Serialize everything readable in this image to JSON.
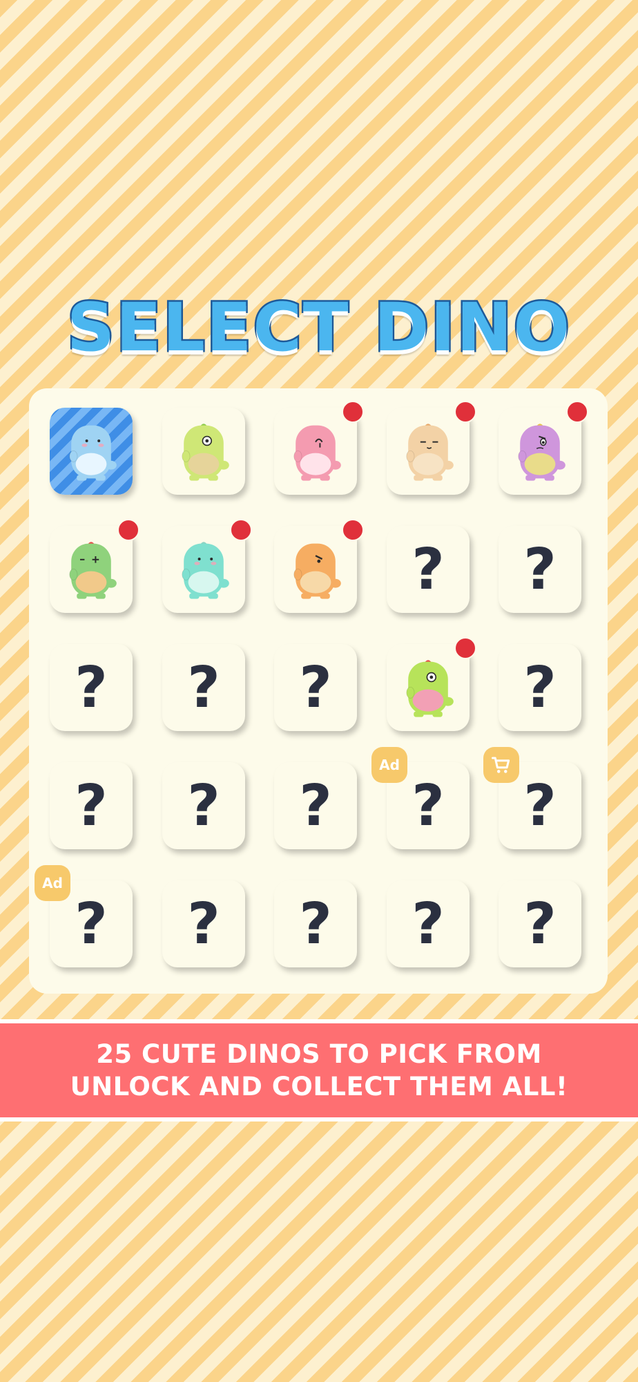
{
  "title": "SELECT DINO",
  "colors": {
    "background_stripe_dark": "#fbd48a",
    "background_stripe_light": "#fdf0cf",
    "panel": "#fdfbea",
    "selected_stripe": "#3f8ee6",
    "notification_dot": "#e0303a",
    "badge": "#f7c96b",
    "banner": "#fe6f72",
    "question_mark": "#2b3040"
  },
  "grid": {
    "rows": [
      [
        {
          "state": "unlocked",
          "selected": true,
          "dino": {
            "body": "#9fd3f3",
            "belly": "#e8f6ff",
            "eyes": "dots",
            "crest": "none"
          }
        },
        {
          "state": "unlocked",
          "dino": {
            "body": "#cfe776",
            "belly": "#e6d49a",
            "eyes": "single",
            "crest": "#8ccb4a"
          }
        },
        {
          "state": "unlocked",
          "dot": true,
          "dino": {
            "body": "#f49bb0",
            "belly": "#ffe3ea",
            "eyes": "wink",
            "crest": "none"
          }
        },
        {
          "state": "unlocked",
          "dot": true,
          "dino": {
            "body": "#f3d2a6",
            "belly": "#f7e3c4",
            "eyes": "sleepy",
            "crest": "#e8a86a"
          }
        },
        {
          "state": "unlocked",
          "dot": true,
          "dino": {
            "body": "#cf96dc",
            "belly": "#e9dc8a",
            "eyes": "grumpy",
            "crest": "#e8c64a"
          }
        }
      ],
      [
        {
          "state": "unlocked",
          "dot": true,
          "dino": {
            "body": "#8fd27c",
            "belly": "#f1c98a",
            "eyes": "cross",
            "crest": "#e84b4b"
          }
        },
        {
          "state": "unlocked",
          "dot": true,
          "dino": {
            "body": "#7fe0cf",
            "belly": "#d7f7ef",
            "eyes": "dots",
            "crest": "#8cd2c2"
          }
        },
        {
          "state": "unlocked",
          "dot": true,
          "dino": {
            "body": "#f6ad62",
            "belly": "#f7d9a8",
            "eyes": "angry",
            "crest": "none"
          }
        },
        {
          "state": "locked"
        },
        {
          "state": "locked"
        }
      ],
      [
        {
          "state": "locked"
        },
        {
          "state": "locked"
        },
        {
          "state": "locked"
        },
        {
          "state": "unlocked",
          "dot": true,
          "dino": {
            "body": "#b7e35a",
            "belly": "#f2a0b5",
            "eyes": "single",
            "crest": "#e84b4b"
          }
        },
        {
          "state": "locked"
        }
      ],
      [
        {
          "state": "locked"
        },
        {
          "state": "locked"
        },
        {
          "state": "locked"
        },
        {
          "state": "locked",
          "badge": "ad",
          "badge_label": "Ad"
        },
        {
          "state": "locked",
          "badge": "shop",
          "badge_icon": "cart-icon"
        }
      ],
      [
        {
          "state": "locked",
          "badge": "ad",
          "badge_label": "Ad"
        },
        {
          "state": "locked"
        },
        {
          "state": "locked"
        },
        {
          "state": "locked"
        },
        {
          "state": "locked"
        }
      ]
    ],
    "locked_symbol": "?"
  },
  "banner": {
    "line1": "25 CUTE DINOS TO PICK FROM",
    "line2": "UNLOCK AND COLLECT THEM ALL!"
  }
}
